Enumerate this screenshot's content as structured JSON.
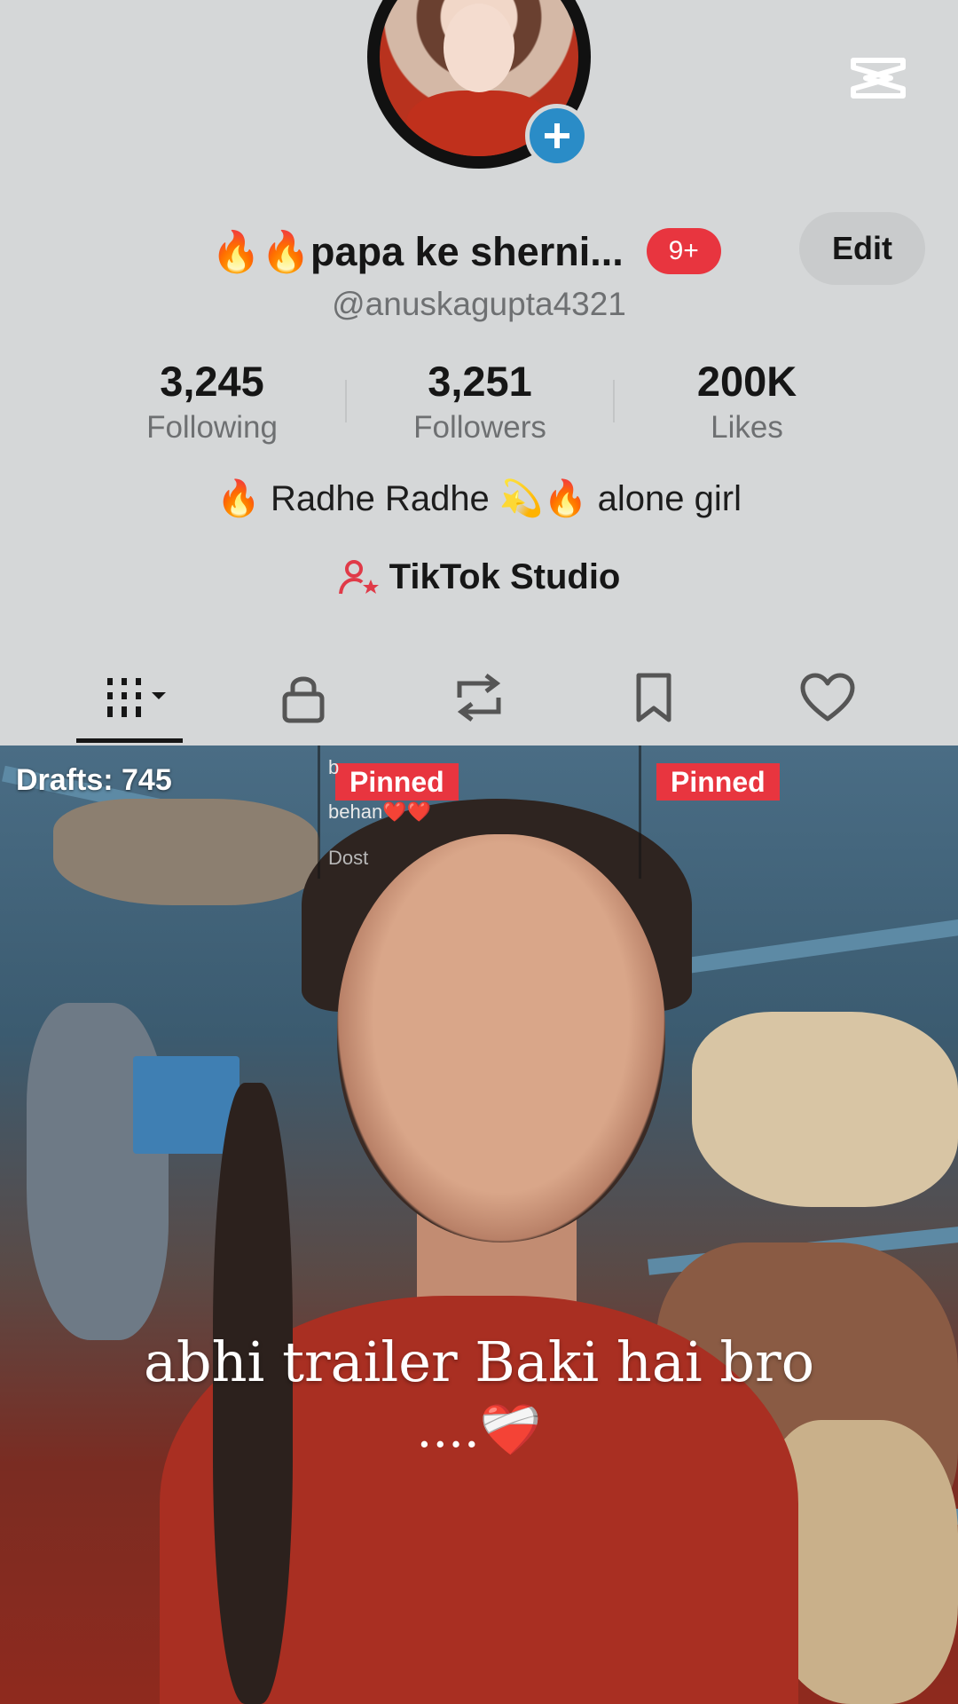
{
  "profile": {
    "display_name": "🔥🔥papa ke sherni...",
    "notification_badge": "9+",
    "edit_label": "Edit",
    "handle": "@anuskagupta4321",
    "add_icon": "plus-icon",
    "app_logo": "capcut-logo"
  },
  "stats": [
    {
      "value": "3,245",
      "label": "Following"
    },
    {
      "value": "3,251",
      "label": "Followers"
    },
    {
      "value": "200K",
      "label": "Likes"
    }
  ],
  "bio": "🔥 Radhe Radhe 💫🔥 alone girl",
  "studio": {
    "label": "TikTok Studio",
    "icon": "person-star-icon"
  },
  "tabs": [
    {
      "icon": "grid-videos-icon",
      "active": true
    },
    {
      "icon": "lock-icon",
      "active": false
    },
    {
      "icon": "repost-icon",
      "active": false
    },
    {
      "icon": "bookmark-icon",
      "active": false
    },
    {
      "icon": "heart-icon",
      "active": false
    }
  ],
  "grid": {
    "drafts_label": "Drafts: 745",
    "pinned_label_1": "Pinned",
    "pinned_label_2": "Pinned",
    "tile_text_1": "b",
    "tile_text_2": "behan❤️❤️",
    "tile_text_3": "Dost",
    "caption_line_1": "abhi trailer Baki hai bro",
    "caption_line_2": "....❤️‍🩹"
  },
  "colors": {
    "background": "#d5d7d8",
    "accent_red": "#e8353f",
    "add_button_blue": "#2a8cc7",
    "studio_icon": "#e03a48"
  }
}
